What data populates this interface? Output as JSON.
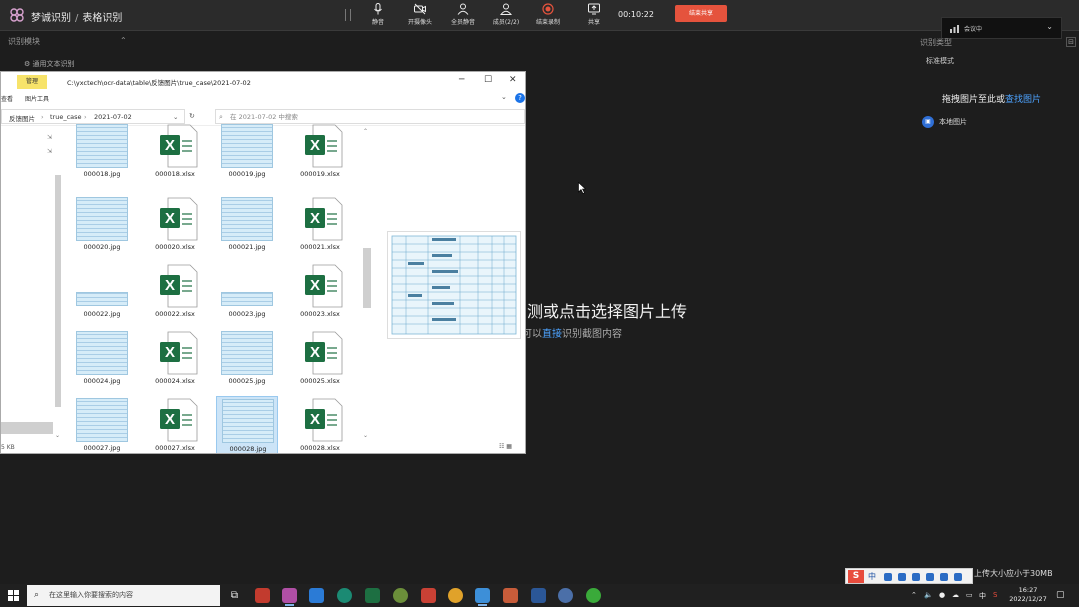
{
  "topbar": {
    "app_name": "梦诚识别",
    "page": "表格识别",
    "buttons": [
      {
        "label": "静音",
        "icon": "microphone-icon"
      },
      {
        "label": "开摄像头",
        "icon": "camera-off-icon"
      },
      {
        "label": "全员静音",
        "icon": "mute-all-icon"
      },
      {
        "label": "成员(2/2)",
        "icon": "members-icon"
      },
      {
        "label": "结束录制",
        "icon": "record-icon"
      },
      {
        "label": "共享",
        "icon": "share-screen-icon"
      }
    ],
    "timer": "00:10:22",
    "end_button": "结束共享"
  },
  "speaking_indicator": "会议中",
  "left_sidebar": {
    "title": "识别模块",
    "item": "通用文本识别"
  },
  "right_panel": {
    "title": "识别类型",
    "subtitle": "标准模式",
    "drag_prefix": "拖拽图片至此或",
    "drag_link": "查找图片",
    "local_image": "本地图片",
    "upload_limit": "上传大小应小于30MB"
  },
  "center": {
    "upload_main": "测或点击选择图片上传",
    "upload_sub_prefix": "也可以",
    "upload_sub_link": "直接",
    "upload_sub_suffix": "识别截图内容"
  },
  "explorer": {
    "manage_tab": "管理",
    "path": "C:\\yxctech\\ocr-data\\table\\反馈图片\\true_case\\2021-07-02",
    "ribbon_left": "查看",
    "ribbon_tools": "图片工具",
    "breadcrumbs": [
      "反馈图片",
      "true_case",
      "2021-07-02"
    ],
    "search_placeholder": "在 2021-07-02 中搜索",
    "status_left": "5 KB",
    "files": [
      {
        "name": "000018.jpg",
        "type": "jpg"
      },
      {
        "name": "000018.xlsx",
        "type": "xlsx"
      },
      {
        "name": "000019.jpg",
        "type": "jpg"
      },
      {
        "name": "000019.xlsx",
        "type": "xlsx"
      },
      {
        "name": "000020.jpg",
        "type": "jpg"
      },
      {
        "name": "000020.xlsx",
        "type": "xlsx"
      },
      {
        "name": "000021.jpg",
        "type": "jpg"
      },
      {
        "name": "000021.xlsx",
        "type": "xlsx"
      },
      {
        "name": "000022.jpg",
        "type": "jpg-wide"
      },
      {
        "name": "000022.xlsx",
        "type": "xlsx"
      },
      {
        "name": "000023.jpg",
        "type": "jpg-wide"
      },
      {
        "name": "000023.xlsx",
        "type": "xlsx"
      },
      {
        "name": "000024.jpg",
        "type": "jpg"
      },
      {
        "name": "000024.xlsx",
        "type": "xlsx"
      },
      {
        "name": "000025.jpg",
        "type": "jpg"
      },
      {
        "name": "000025.xlsx",
        "type": "xlsx"
      },
      {
        "name": "000027.jpg",
        "type": "jpg"
      },
      {
        "name": "000027.xlsx",
        "type": "xlsx"
      },
      {
        "name": "000028.jpg",
        "type": "jpg",
        "selected": true
      },
      {
        "name": "000028.xlsx",
        "type": "xlsx"
      }
    ]
  },
  "taskbar": {
    "search_placeholder": "在这里输入你要搜索的内容",
    "ime": "中",
    "ime_bar_lang": "中",
    "time": "16:27",
    "date": "2022/12/27"
  },
  "colors": {
    "accent": "#e5533d",
    "link": "#4da3ff",
    "excel_green": "#1d6f42"
  }
}
